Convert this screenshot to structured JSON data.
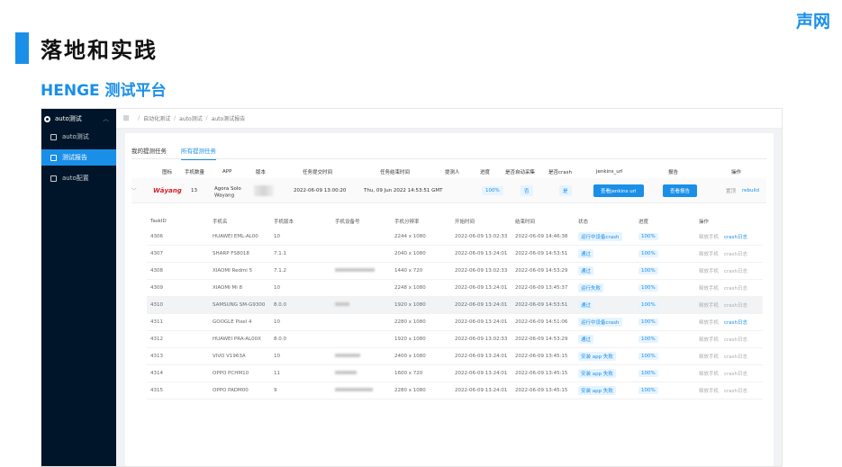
{
  "slide": {
    "brand": "声网",
    "title": "落地和实践",
    "subtitle": "HENGE 测试平台"
  },
  "colors": {
    "accent": "#1a8fe8",
    "sidebar": "#001529"
  },
  "sidebar": {
    "root": "auto测试",
    "items": [
      {
        "label": "auto测试",
        "icon": "upload-icon"
      },
      {
        "label": "测试报告",
        "icon": "document-icon",
        "active": true
      },
      {
        "label": "auto配置",
        "icon": "document-icon"
      }
    ]
  },
  "breadcrumb": [
    "自动化测试",
    "auto测试",
    "auto测试报告"
  ],
  "tabs": [
    "我的提测任务",
    "所有提测任务"
  ],
  "task_table": {
    "headers": [
      "图标",
      "手机数量",
      "APP",
      "版本",
      "任务提交时间",
      "任务结束时间",
      "提测人",
      "进度",
      "是否自动采集",
      "是否crash",
      "jenkins_url",
      "报告",
      "操作"
    ],
    "row": {
      "logo": "Wāyang",
      "count": "13",
      "app_line1": "Agora Solo",
      "app_line2": "Wayang",
      "submitted": "2022-06-09 13:00:20",
      "finished": "Thu, 09 Jun 2022 14:53:51 GMT",
      "progress": "100%",
      "auto": "否",
      "crash": "是",
      "jenkins": "查看jenkins url",
      "report": "查看报告",
      "pin": "置顶",
      "rebuild": "rebuild"
    }
  },
  "sub_table": {
    "headers": [
      "TaskID",
      "手机名",
      "手机版本",
      "手机设备号",
      "手机分辨率",
      "开始时间",
      "结束时间",
      "状态",
      "进度",
      "操作"
    ],
    "rows": [
      {
        "id": "4306",
        "name": "HUAWEI EML-AL00",
        "ver": "10",
        "res": "2244 x 1080",
        "start": "2022-06-09 13:02:33",
        "end": "2022-06-09 14:46:38",
        "status": "运行中设备crash",
        "progress": "100%",
        "op1": "释放手机",
        "op2": "crash日志",
        "op2_link": true
      },
      {
        "id": "4307",
        "name": "SHARP FS8018",
        "ver": "7.1.1",
        "res": "2040 x 1080",
        "start": "2022-06-09 13:24:01",
        "end": "2022-06-09 14:53:51",
        "status": "通过",
        "progress": "100%",
        "op1": "释放手机",
        "op2": "crash日志",
        "op2_link": false
      },
      {
        "id": "4308",
        "name": "XIAOMI Redmi 5",
        "ver": "7.1.2",
        "res": "1440 x 720",
        "start": "2022-06-09 13:02:33",
        "end": "2022-06-09 14:53:29",
        "status": "通过",
        "progress": "100%",
        "op1": "释放手机",
        "op2": "crash日志",
        "op2_link": false
      },
      {
        "id": "4309",
        "name": "XIAOMI Mi 8",
        "ver": "10",
        "res": "2248 x 1080",
        "start": "2022-06-09 13:24:01",
        "end": "2022-06-09 13:45:37",
        "status": "运行失败",
        "progress": "100%",
        "op1": "释放手机",
        "op2": "crash日志",
        "op2_link": false
      },
      {
        "id": "4310",
        "name": "SAMSUNG SM-G9300",
        "ver": "8.0.0",
        "res": "1920 x 1080",
        "start": "2022-06-09 13:24:01",
        "end": "2022-06-09 14:53:51",
        "status": "通过",
        "progress": "100%",
        "op1": "释放手机",
        "op2": "crash日志",
        "op2_link": false
      },
      {
        "id": "4311",
        "name": "GOOGLE Pixel 4",
        "ver": "10",
        "res": "2280 x 1080",
        "start": "2022-06-09 13:24:01",
        "end": "2022-06-09 14:51:06",
        "status": "运行中设备crash",
        "progress": "100%",
        "op1": "释放手机",
        "op2": "crash日志",
        "op2_link": true
      },
      {
        "id": "4312",
        "name": "HUAWEI PRA-AL00X",
        "ver": "8.0.0",
        "res": "1920 x 1080",
        "start": "2022-06-09 13:02:33",
        "end": "2022-06-09 14:53:29",
        "status": "通过",
        "progress": "100%",
        "op1": "释放手机",
        "op2": "crash日志",
        "op2_link": false
      },
      {
        "id": "4313",
        "name": "VIVO V1963A",
        "ver": "10",
        "res": "2400 x 1080",
        "start": "2022-06-09 13:24:01",
        "end": "2022-06-09 13:45:15",
        "status": "安装 app 失败",
        "progress": "100%",
        "op1": "释放手机",
        "op2": "crash日志",
        "op2_link": false
      },
      {
        "id": "4314",
        "name": "OPPO PCHM10",
        "ver": "11",
        "res": "1600 x 720",
        "start": "2022-06-09 13:24:01",
        "end": "2022-06-09 13:45:15",
        "status": "安装 app 失败",
        "progress": "100%",
        "op1": "释放手机",
        "op2": "crash日志",
        "op2_link": false
      },
      {
        "id": "4315",
        "name": "OPPO PADM00",
        "ver": "9",
        "res": "2280 x 1080",
        "start": "2022-06-09 13:24:01",
        "end": "2022-06-09 13:45:15",
        "status": "安装 app 失败",
        "progress": "100%",
        "op1": "释放手机",
        "op2": "crash日志",
        "op2_link": false
      }
    ]
  }
}
